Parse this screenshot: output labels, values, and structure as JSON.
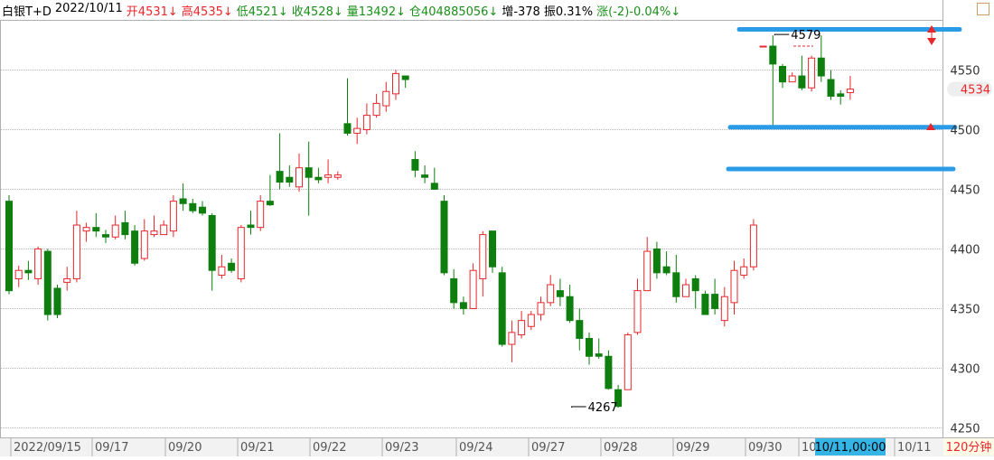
{
  "header": {
    "name": "白银T+D",
    "date": "2022/10/11",
    "open": "开4531↓",
    "high": "高4535↓",
    "low": "低4521↓",
    "close": "收4528↓",
    "volume": "量13492↓",
    "position": "仓404885056↓",
    "increase": "增-378",
    "amplitude": "振0.31%",
    "change": "涨(-2)-0.04%↓"
  },
  "price_label": "4534",
  "timeframe": "120分钟",
  "cursor_time": "10/11,00:00",
  "colors": {
    "up": "#e8262b",
    "down": "#0e7f0e",
    "accent_line": "#2a9be6",
    "grid": "#9a9a9a",
    "cursor_bg": "#35b4e6"
  },
  "chart_data": {
    "type": "candlestick",
    "ylim": [
      4242,
      4592
    ],
    "y_ticks": [
      4250,
      4300,
      4350,
      4400,
      4450,
      4500,
      4550
    ],
    "x_ticks": [
      "2022/09/15",
      "09/17",
      "09/20",
      "09/21",
      "09/22",
      "09/23",
      "09/24",
      "09/27",
      "09/28",
      "09/29",
      "09/30",
      "10",
      "10/11"
    ],
    "annotations": [
      {
        "text": "4579",
        "bar": 79,
        "value": 4579
      },
      {
        "text": "4267",
        "bar": 58,
        "value": 4267
      }
    ],
    "horizontal_lines": [
      4584,
      4502,
      4467
    ],
    "candles": [
      [
        4440,
        4365,
        4445,
        4362
      ],
      [
        4375,
        4382,
        4386,
        4368
      ],
      [
        4382,
        4380,
        4390,
        4374
      ],
      [
        4375,
        4400,
        4402,
        4370
      ],
      [
        4398,
        4345,
        4400,
        4340
      ],
      [
        4367,
        4345,
        4370,
        4342
      ],
      [
        4372,
        4375,
        4385,
        4365
      ],
      [
        4375,
        4420,
        4432,
        4372
      ],
      [
        4415,
        4418,
        4422,
        4406
      ],
      [
        4418,
        4415,
        4430,
        4410
      ],
      [
        4412,
        4410,
        4416,
        4405
      ],
      [
        4410,
        4420,
        4428,
        4408
      ],
      [
        4422,
        4412,
        4432,
        4408
      ],
      [
        4415,
        4388,
        4420,
        4386
      ],
      [
        4392,
        4415,
        4425,
        4390
      ],
      [
        4412,
        4415,
        4428,
        4410
      ],
      [
        4412,
        4420,
        4424,
        4412
      ],
      [
        4415,
        4440,
        4445,
        4410
      ],
      [
        4442,
        4438,
        4455,
        4432
      ],
      [
        4438,
        4432,
        4442,
        4430
      ],
      [
        4435,
        4430,
        4440,
        4428
      ],
      [
        4428,
        4382,
        4430,
        4365
      ],
      [
        4378,
        4385,
        4395,
        4375
      ],
      [
        4388,
        4382,
        4392,
        4380
      ],
      [
        4375,
        4418,
        4420,
        4372
      ],
      [
        4420,
        4418,
        4432,
        4412
      ],
      [
        4418,
        4440,
        4445,
        4415
      ],
      [
        4440,
        4437,
        4462,
        4436
      ],
      [
        4465,
        4456,
        4497,
        4450
      ],
      [
        4460,
        4456,
        4470,
        4452
      ],
      [
        4452,
        4468,
        4480,
        4448
      ],
      [
        4468,
        4460,
        4490,
        4428
      ],
      [
        4460,
        4458,
        4468,
        4455
      ],
      [
        4460,
        4462,
        4475,
        4455
      ],
      [
        4460,
        4462,
        4465,
        4458
      ],
      [
        4505,
        4497,
        4543,
        4495
      ],
      [
        4497,
        4501,
        4510,
        4488
      ],
      [
        4500,
        4512,
        4522,
        4496
      ],
      [
        4512,
        4522,
        4530,
        4510
      ],
      [
        4520,
        4532,
        4540,
        4515
      ],
      [
        4530,
        4547,
        4550,
        4525
      ],
      [
        4545,
        4542,
        4545,
        4535
      ],
      [
        4475,
        4466,
        4482,
        4460
      ],
      [
        4462,
        4460,
        4470,
        4455
      ],
      [
        4455,
        4450,
        4468,
        4450
      ],
      [
        4440,
        4380,
        4445,
        4378
      ],
      [
        4375,
        4355,
        4383,
        4350
      ],
      [
        4355,
        4350,
        4360,
        4345
      ],
      [
        4350,
        4382,
        4388,
        4350
      ],
      [
        4375,
        4412,
        4415,
        4360
      ],
      [
        4415,
        4385,
        4415,
        4380
      ],
      [
        4380,
        4320,
        4385,
        4318
      ],
      [
        4320,
        4330,
        4340,
        4305
      ],
      [
        4328,
        4340,
        4348,
        4325
      ],
      [
        4335,
        4345,
        4348,
        4332
      ],
      [
        4345,
        4355,
        4360,
        4340
      ],
      [
        4355,
        4370,
        4378,
        4352
      ],
      [
        4365,
        4360,
        4375,
        4352
      ],
      [
        4360,
        4340,
        4370,
        4338
      ],
      [
        4340,
        4325,
        4350,
        4315
      ],
      [
        4325,
        4310,
        4330,
        4303
      ],
      [
        4312,
        4310,
        4325,
        4308
      ],
      [
        4310,
        4283,
        4315,
        4282
      ],
      [
        4282,
        4268,
        4286,
        4267
      ],
      [
        4282,
        4328,
        4330,
        4282
      ],
      [
        4330,
        4365,
        4375,
        4328
      ],
      [
        4365,
        4398,
        4410,
        4365
      ],
      [
        4400,
        4380,
        4406,
        4375
      ],
      [
        4385,
        4380,
        4398,
        4378
      ],
      [
        4380,
        4360,
        4395,
        4355
      ],
      [
        4360,
        4370,
        4375,
        4360
      ],
      [
        4375,
        4365,
        4378,
        4350
      ],
      [
        4362,
        4345,
        4365,
        4345
      ],
      [
        4362,
        4350,
        4375,
        4345
      ],
      [
        4340,
        4360,
        4368,
        4335
      ],
      [
        4355,
        4382,
        4390,
        4345
      ],
      [
        4378,
        4385,
        4392,
        4375
      ],
      [
        4385,
        4420,
        4425,
        4382
      ],
      [
        4570,
        4570,
        4570,
        4570
      ],
      [
        4570,
        4555,
        4579,
        4502
      ],
      [
        4553,
        4540,
        4555,
        4535
      ],
      [
        4540,
        4545,
        4548,
        4540
      ],
      [
        4545,
        4535,
        4562,
        4533
      ],
      [
        4535,
        4560,
        4562,
        4532
      ],
      [
        4560,
        4545,
        4579,
        4540
      ],
      [
        4542,
        4528,
        4550,
        4525
      ],
      [
        4530,
        4528,
        4533,
        4521
      ],
      [
        4531,
        4534,
        4545,
        4525
      ]
    ]
  }
}
